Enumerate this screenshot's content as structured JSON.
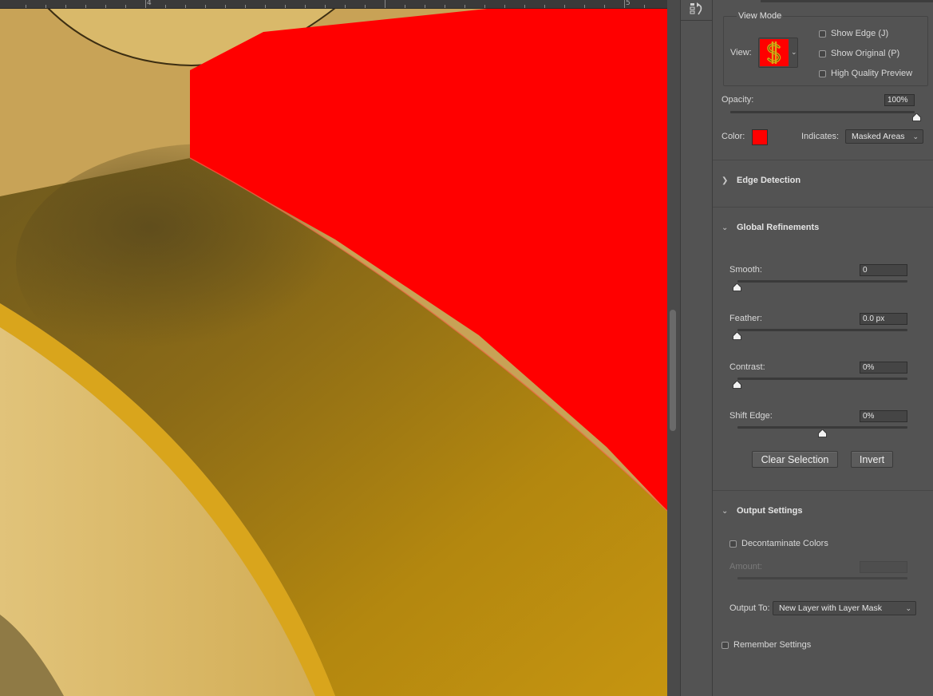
{
  "ruler": {
    "marks": [
      "4",
      "5"
    ]
  },
  "view_mode": {
    "legend": "View Mode",
    "view_label": "View:",
    "view_thumb_icon": "dollar-sign-icon",
    "options": [
      {
        "label": "Show Edge (J)",
        "checked": false
      },
      {
        "label": "Show Original (P)",
        "checked": false
      },
      {
        "label": "High Quality Preview",
        "checked": false
      }
    ]
  },
  "opacity": {
    "label": "Opacity:",
    "value": "100%",
    "level": 1.0
  },
  "color": {
    "label": "Color:",
    "swatch": "#ff0000",
    "indicates_label": "Indicates:",
    "indicates_value": "Masked Areas"
  },
  "edge_detection": {
    "title": "Edge Detection",
    "expanded": false
  },
  "global_refinements": {
    "title": "Global Refinements",
    "expanded": true,
    "sliders": [
      {
        "label": "Smooth:",
        "value": "0",
        "level": 0.0
      },
      {
        "label": "Feather:",
        "value": "0.0 px",
        "level": 0.0
      },
      {
        "label": "Contrast:",
        "value": "0%",
        "level": 0.0
      },
      {
        "label": "Shift Edge:",
        "value": "0%",
        "level": 0.5
      }
    ],
    "clear_selection": "Clear Selection",
    "invert": "Invert"
  },
  "output_settings": {
    "title": "Output Settings",
    "expanded": true,
    "decontaminate": {
      "label": "Decontaminate Colors",
      "checked": false
    },
    "amount_label": "Amount:",
    "output_to_label": "Output To:",
    "output_to_value": "New Layer with Layer Mask"
  },
  "remember": {
    "label": "Remember Settings",
    "checked": false
  },
  "colors": {
    "mask_red": "#ff0000",
    "panel_bg": "#535353",
    "gold": "#c9a557"
  }
}
